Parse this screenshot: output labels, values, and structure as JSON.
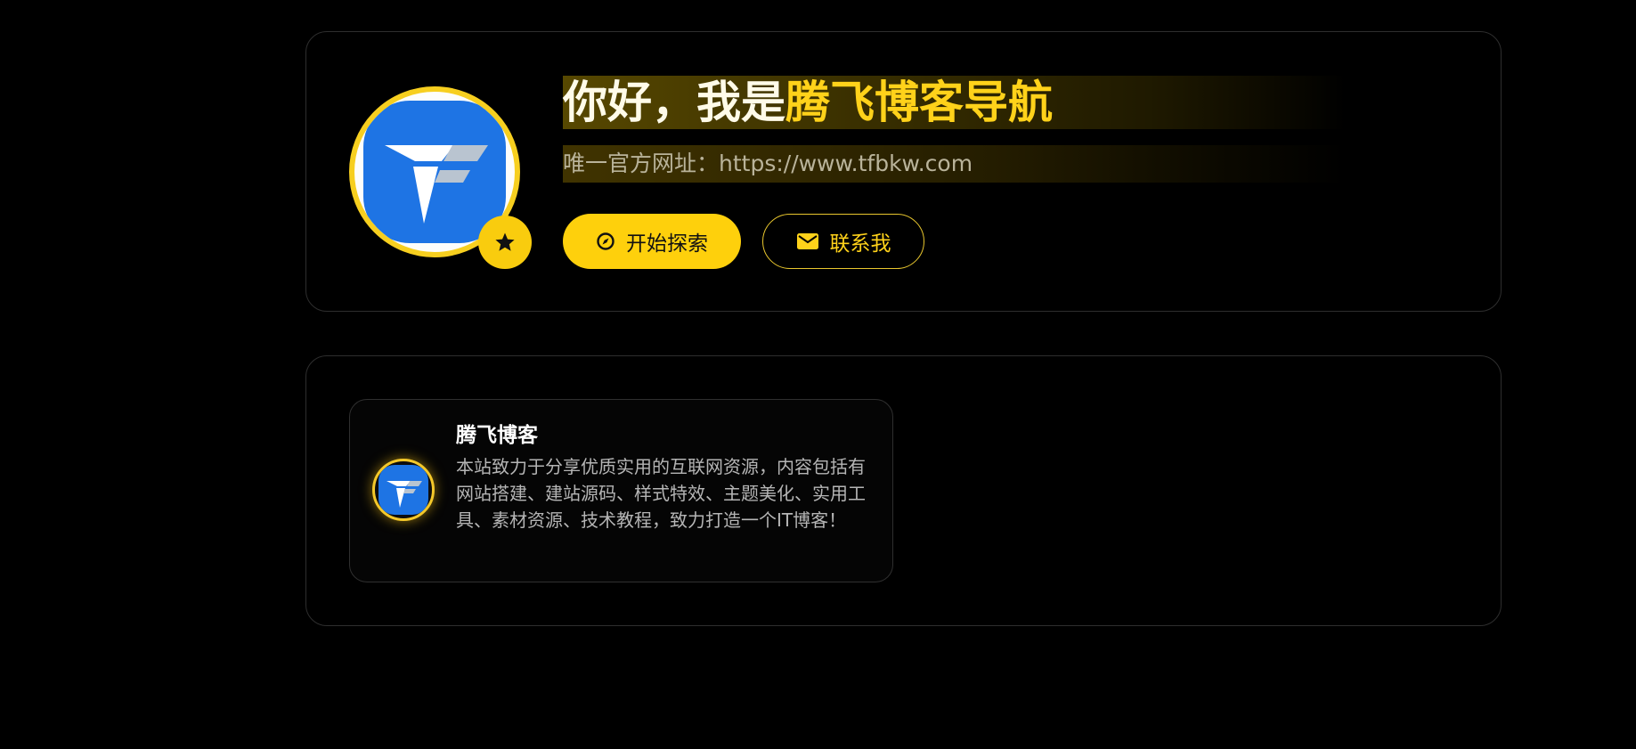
{
  "hero": {
    "title_prefix": "你好，我是",
    "title_highlight": "腾飞博客导航",
    "subtitle": "唯一官方网址：https://www.tfbkw.com",
    "avatar_icon": "tf-logo-icon",
    "badge_icon": "star-icon",
    "buttons": {
      "explore_label": "开始探索",
      "explore_icon": "compass-icon",
      "contact_label": "联系我",
      "contact_icon": "envelope-icon"
    }
  },
  "sites": [
    {
      "name": "腾飞博客",
      "description": "本站致力于分享优质实用的互联网资源，内容包括有网站搭建、建站源码、样式特效、主题美化、实用工具、素材资源、技术教程，致力打造一个IT博客！",
      "icon": "tf-logo-icon"
    }
  ],
  "colors": {
    "background": "#000000",
    "accent": "#fed00c",
    "card_border": "#2e2e2e",
    "logo_blue": "#1e74e4"
  }
}
